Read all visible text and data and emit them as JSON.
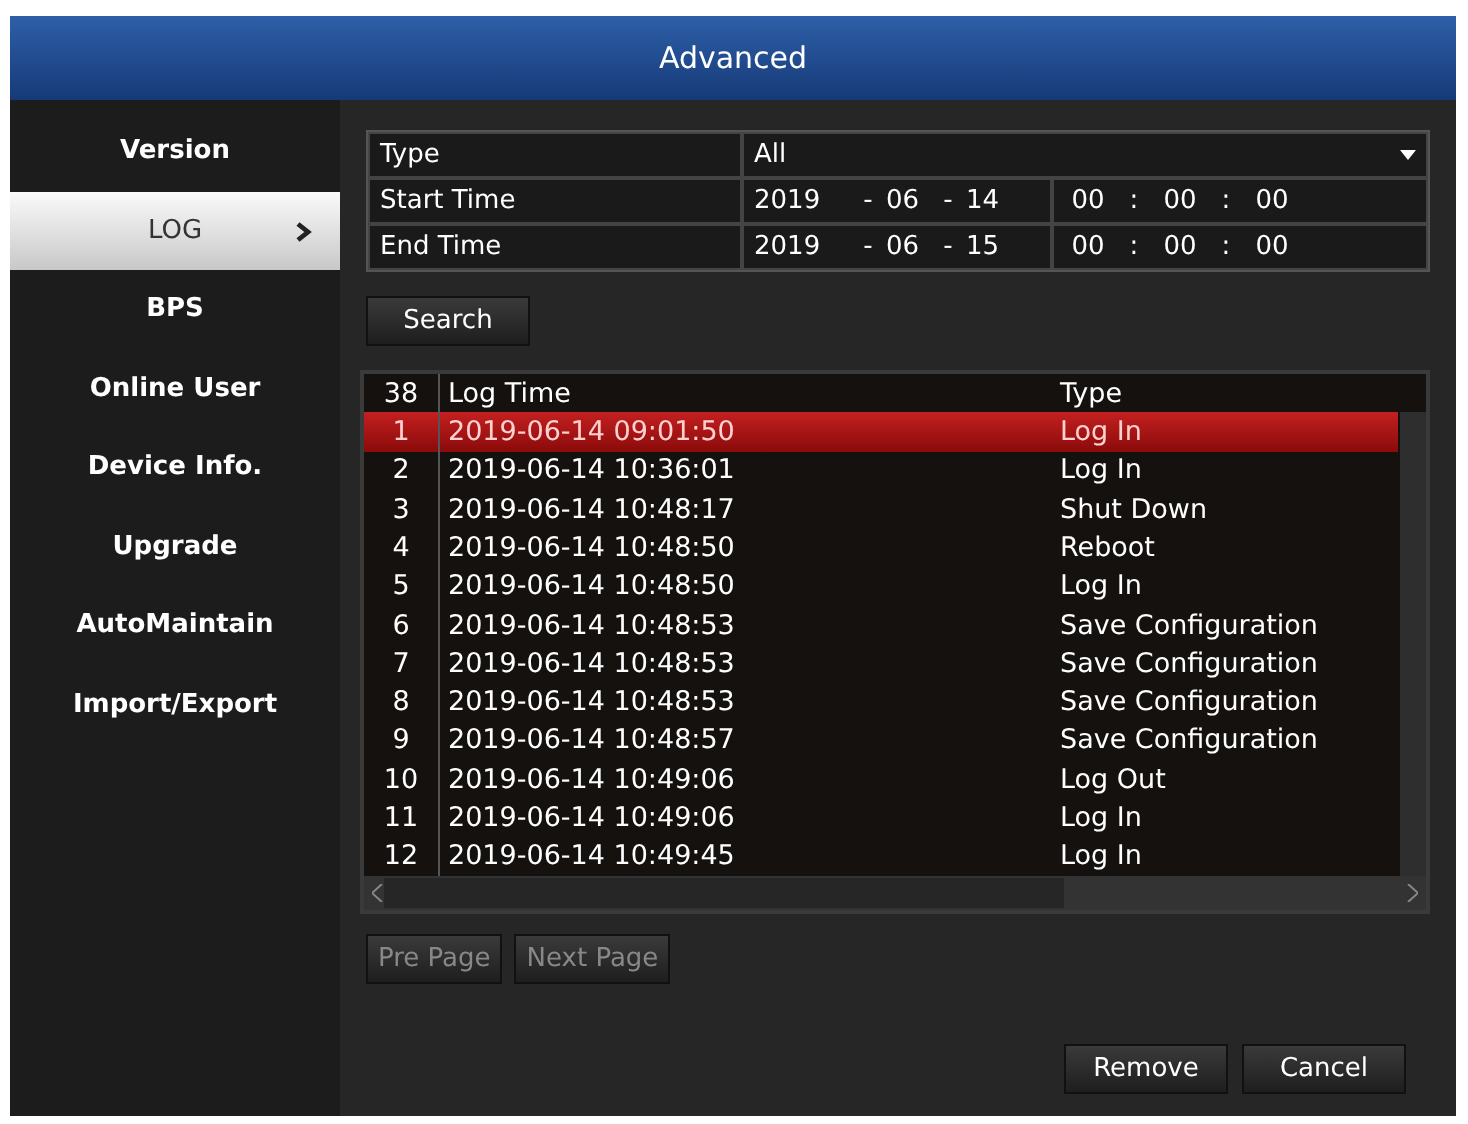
{
  "window": {
    "title": "Advanced"
  },
  "sidebar": {
    "items": [
      {
        "label": "Version",
        "selected": false
      },
      {
        "label": "LOG",
        "selected": true
      },
      {
        "label": "BPS",
        "selected": false
      },
      {
        "label": "Online User",
        "selected": false
      },
      {
        "label": "Device Info.",
        "selected": false
      },
      {
        "label": "Upgrade",
        "selected": false
      },
      {
        "label": "AutoMaintain",
        "selected": false
      },
      {
        "label": "Import/Export",
        "selected": false
      }
    ]
  },
  "filter": {
    "type": {
      "label": "Type",
      "value": "All"
    },
    "start_time": {
      "label": "Start Time",
      "date": [
        "2019",
        "-",
        "06",
        "-",
        "14"
      ],
      "time": [
        "00",
        ":",
        "00",
        ":",
        "00"
      ]
    },
    "end_time": {
      "label": "End Time",
      "date": [
        "2019",
        "-",
        "06",
        "-",
        "15"
      ],
      "time": [
        "00",
        ":",
        "00",
        ":",
        "00"
      ]
    },
    "search_button": "Search"
  },
  "log_table": {
    "columns": [
      "38",
      "Log Time",
      "Type"
    ],
    "rows": [
      {
        "number": "1",
        "time": "2019-06-14 09:01:50",
        "type": "Log In",
        "selected": true
      },
      {
        "number": "2",
        "time": "2019-06-14 10:36:01",
        "type": "Log In",
        "selected": false
      },
      {
        "number": "3",
        "time": "2019-06-14 10:48:17",
        "type": "Shut Down",
        "selected": false
      },
      {
        "number": "4",
        "time": "2019-06-14 10:48:50",
        "type": "Reboot",
        "selected": false
      },
      {
        "number": "5",
        "time": "2019-06-14 10:48:50",
        "type": "Log In",
        "selected": false
      },
      {
        "number": "6",
        "time": "2019-06-14 10:48:53",
        "type": "Save Configuration",
        "selected": false
      },
      {
        "number": "7",
        "time": "2019-06-14 10:48:53",
        "type": "Save Configuration",
        "selected": false
      },
      {
        "number": "8",
        "time": "2019-06-14 10:48:53",
        "type": "Save Configuration",
        "selected": false
      },
      {
        "number": "9",
        "time": "2019-06-14 10:48:57",
        "type": "Save Configuration",
        "selected": false
      },
      {
        "number": "10",
        "time": "2019-06-14 10:49:06",
        "type": "Log Out",
        "selected": false
      },
      {
        "number": "11",
        "time": "2019-06-14 10:49:06",
        "type": "Log In",
        "selected": false
      },
      {
        "number": "12",
        "time": "2019-06-14 10:49:45",
        "type": "Log In",
        "selected": false
      }
    ]
  },
  "paging": [
    {
      "label": "Pre Page",
      "disabled": true
    },
    {
      "label": "Next Page",
      "disabled": true
    }
  ],
  "buttons": [
    "Remove",
    "Cancel"
  ]
}
